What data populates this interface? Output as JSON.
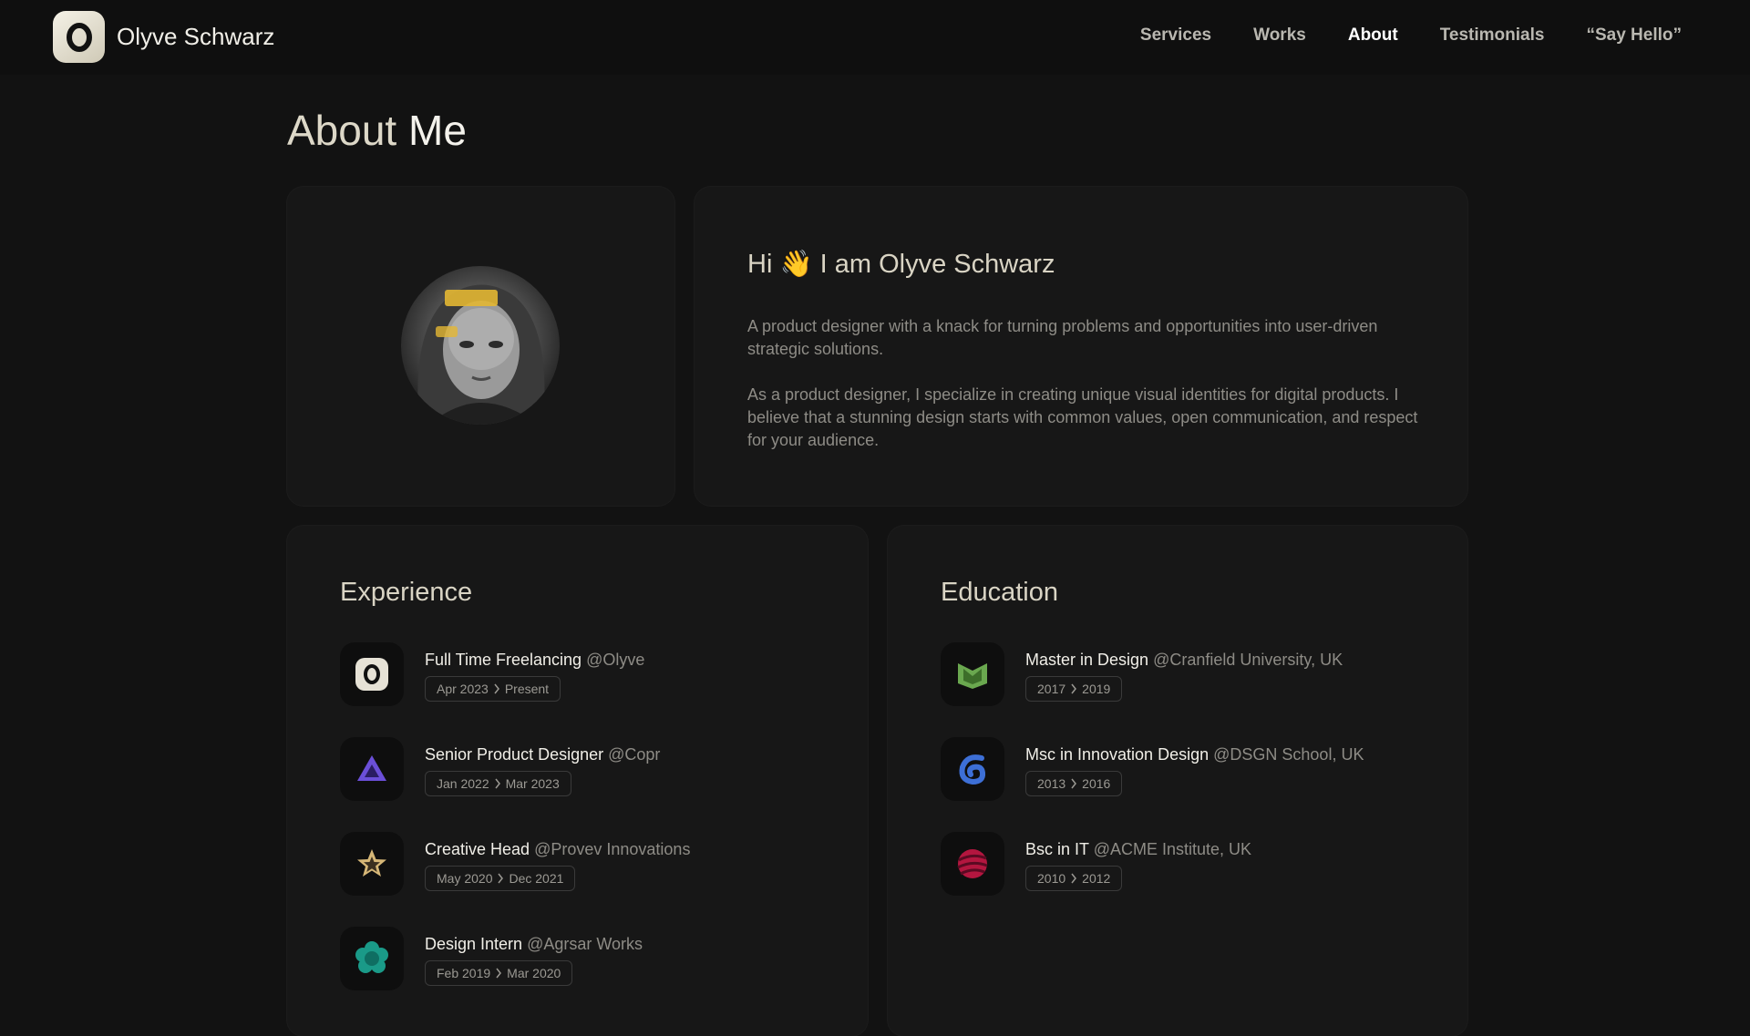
{
  "brand": {
    "name": "Olyve Schwarz",
    "logo_icon": "o-logo-icon"
  },
  "nav": {
    "items": [
      {
        "label": "Services",
        "active": false
      },
      {
        "label": "Works",
        "active": false
      },
      {
        "label": "About",
        "active": true
      },
      {
        "label": "Testimonials",
        "active": false
      },
      {
        "label": "“Say Hello”",
        "active": false
      }
    ]
  },
  "page": {
    "title_prefix": "About",
    "title_strong": "Me"
  },
  "intro": {
    "greeting_before": "Hi",
    "greeting_emoji": "👋",
    "greeting_after": "I am Olyve Schwarz",
    "bio_1": "A product designer with a knack for turning problems and opportunities into user-driven strategic solutions.",
    "bio_2": "As a product designer, I specialize in creating unique visual identities for digital products. I believe that a stunning design starts with common values, open communication, and respect for your audience."
  },
  "experience": {
    "title": "Experience",
    "items": [
      {
        "role": "Full Time Freelancing",
        "org": "@Olyve",
        "start": "Apr 2023",
        "end": "Present",
        "icon": "olyve-logo-icon"
      },
      {
        "role": "Senior Product Designer",
        "org": "@Copr",
        "start": "Jan 2022",
        "end": "Mar 2023",
        "icon": "purple-triangle-icon"
      },
      {
        "role": "Creative Head",
        "org": "@Provev Innovations",
        "start": "May 2020",
        "end": "Dec 2021",
        "icon": "gold-star-icon"
      },
      {
        "role": "Design Intern",
        "org": "@Agrsar Works",
        "start": "Feb 2019",
        "end": "Mar 2020",
        "icon": "teal-flower-icon"
      }
    ]
  },
  "education": {
    "title": "Education",
    "items": [
      {
        "role": "Master in Design",
        "org": "@Cranfield University, UK",
        "start": "2017",
        "end": "2019",
        "icon": "green-m-icon"
      },
      {
        "role": "Msc in Innovation Design",
        "org": "@DSGN School, UK",
        "start": "2013",
        "end": "2016",
        "icon": "blue-swirl-icon"
      },
      {
        "role": "Bsc in IT",
        "org": "@ACME Institute, UK",
        "start": "2010",
        "end": "2012",
        "icon": "red-sphere-icon"
      }
    ]
  },
  "colors": {
    "background": "#121212",
    "card": "#171717",
    "text": "#f1efe8",
    "muted": "#8e8c86"
  }
}
